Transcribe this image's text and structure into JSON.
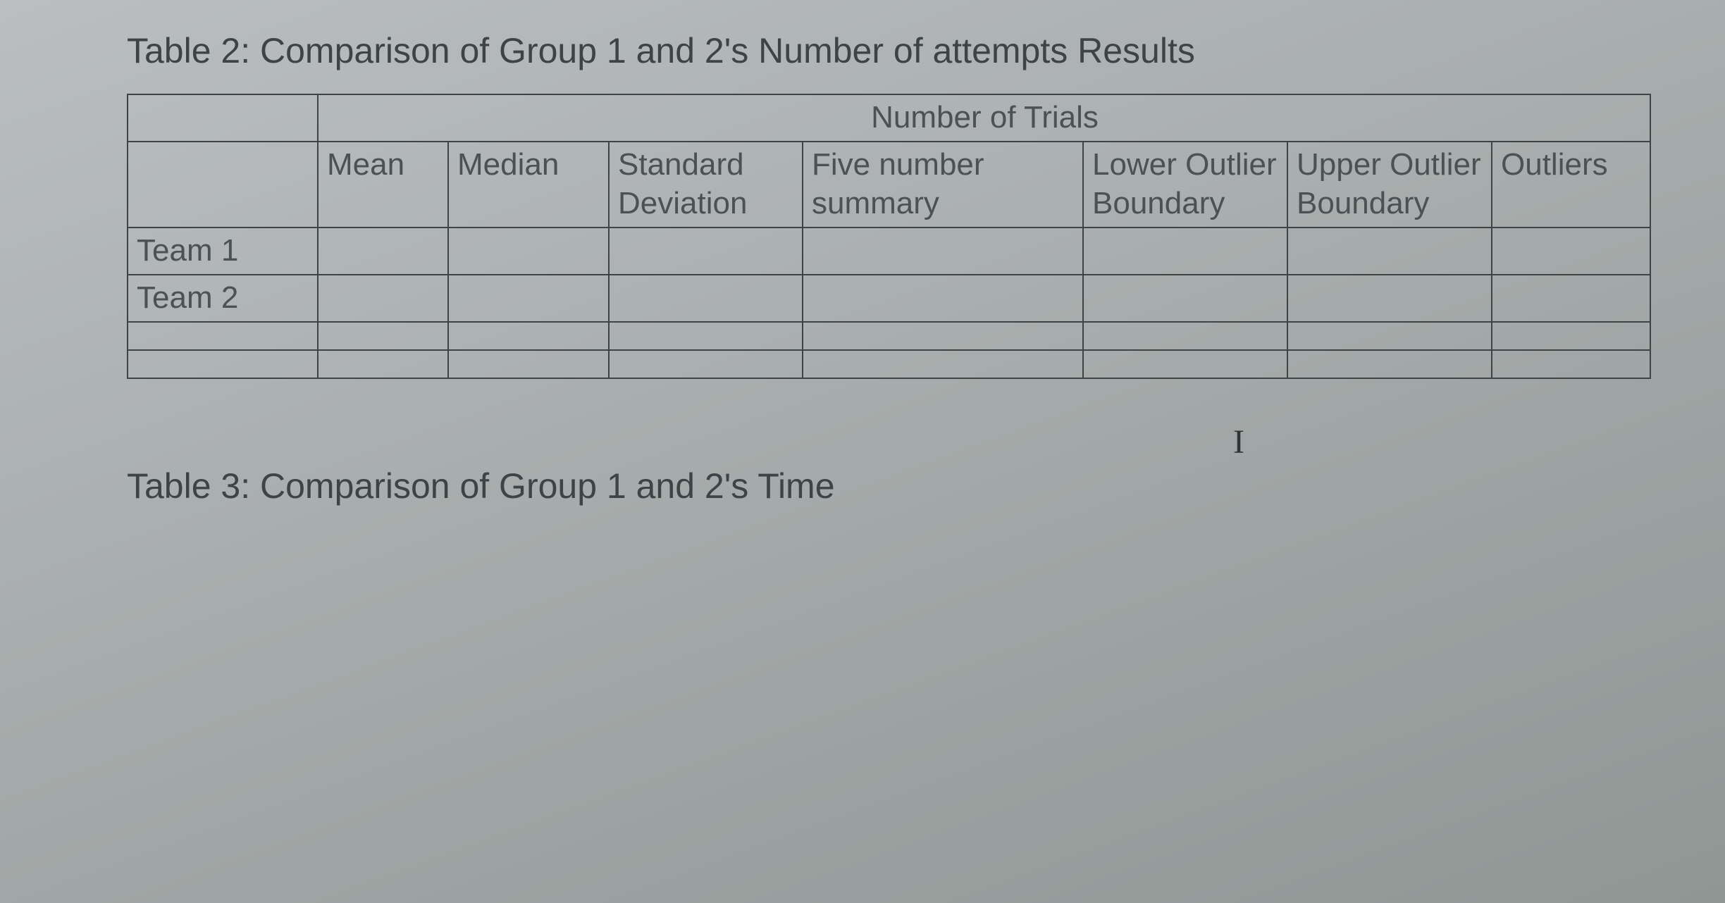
{
  "table2": {
    "title": "Table 2: Comparison of Group 1 and 2's Number of attempts Results",
    "group_header": "Number of Trials",
    "columns": {
      "mean": "Mean",
      "median": "Median",
      "std": "Standard Deviation",
      "five": "Five number summary",
      "lower": "Lower Outlier Boundary",
      "upper": "Upper Outlier Boundary",
      "outliers": "Outliers"
    },
    "rows": [
      {
        "label": "Team 1",
        "mean": "",
        "median": "",
        "std": "",
        "five": "",
        "lower": "",
        "upper": "",
        "outliers": ""
      },
      {
        "label": "Team 2",
        "mean": "",
        "median": "",
        "std": "",
        "five": "",
        "lower": "",
        "upper": "",
        "outliers": ""
      },
      {
        "label": "",
        "mean": "",
        "median": "",
        "std": "",
        "five": "",
        "lower": "",
        "upper": "",
        "outliers": ""
      },
      {
        "label": "",
        "mean": "",
        "median": "",
        "std": "",
        "five": "",
        "lower": "",
        "upper": "",
        "outliers": ""
      }
    ]
  },
  "table3": {
    "title": "Table 3: Comparison of Group 1 and 2's Time"
  },
  "cursor_glyph": "I"
}
